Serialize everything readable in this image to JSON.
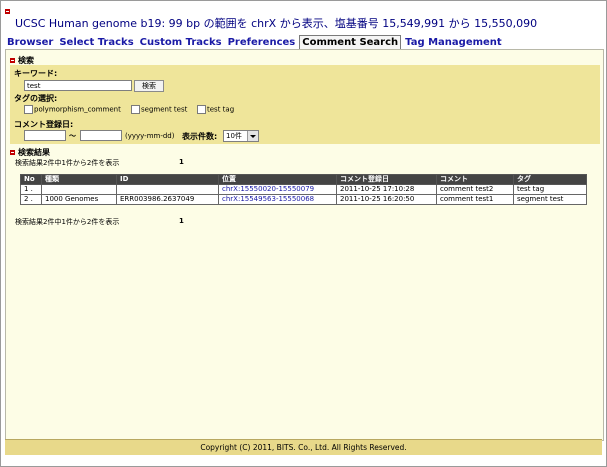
{
  "header": {
    "title": "UCSC Human genome b19: 99 bp の範囲を chrX から表示、塩基番号 15,549,991 から 15,550,090"
  },
  "nav": {
    "tabs": [
      {
        "label": "Browser"
      },
      {
        "label": "Select Tracks"
      },
      {
        "label": "Custom Tracks"
      },
      {
        "label": "Preferences"
      },
      {
        "label": "Comment Search"
      },
      {
        "label": "Tag Management"
      }
    ],
    "active_index": 4
  },
  "search": {
    "section_title": "検索",
    "keyword_label": "キーワード:",
    "keyword_value": "test",
    "search_button": "検索",
    "tag_label": "タグの選択:",
    "tags": [
      {
        "label": "polymorphism_comment",
        "checked": false
      },
      {
        "label": "segment test",
        "checked": false
      },
      {
        "label": "test tag",
        "checked": false
      }
    ],
    "date_label": "コメント登録日:",
    "date_separator": "〜",
    "date_format_hint": "(yyyy-mm-dd)",
    "count_label": "表示件数:",
    "count_value": "10件"
  },
  "results": {
    "section_title": "検索結果",
    "summary_text": "検索結果2件中1件から2件を表示",
    "page_number": "1",
    "columns": [
      "No",
      "種類",
      "ID",
      "位置",
      "コメント登録日",
      "コメント",
      "タグ"
    ],
    "rows": [
      {
        "no": "1 .",
        "type": "",
        "id": "",
        "position": "chrX:15550020-15550079",
        "date": "2011-10-25 17:10:28",
        "comment": "comment test2",
        "tag": "test tag"
      },
      {
        "no": "2 .",
        "type": "1000 Genomes",
        "id": "ERR003986.2637049",
        "position": "chrX:15549563-15550068",
        "date": "2011-10-25 16:20:50",
        "comment": "comment test1",
        "tag": "segment test"
      }
    ],
    "summary_text_bottom": "検索結果2件中1件から2件を表示",
    "page_number_bottom": "1"
  },
  "footer": {
    "copyright": "Copyright (C) 2011, BITS. Co., Ltd. All Rights Reserved."
  },
  "colors": {
    "link": "#1a1aa6",
    "title": "#000080",
    "panel": "#efe59a",
    "main_bg": "#fdfde6",
    "table_header": "#444444",
    "collapse_icon": "#c00000"
  }
}
